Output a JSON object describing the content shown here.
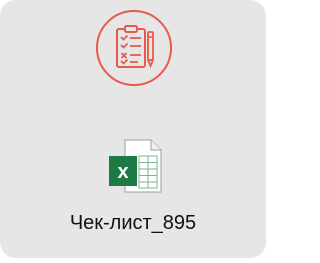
{
  "card": {
    "badge_icon": "checklist-clipboard-icon",
    "badge_color": "#e85a4f",
    "file_icon": "excel-spreadsheet-icon",
    "file_icon_color": "#1e7a45",
    "file_name": "Чек-лист_895",
    "file_badge_letter": "x"
  }
}
